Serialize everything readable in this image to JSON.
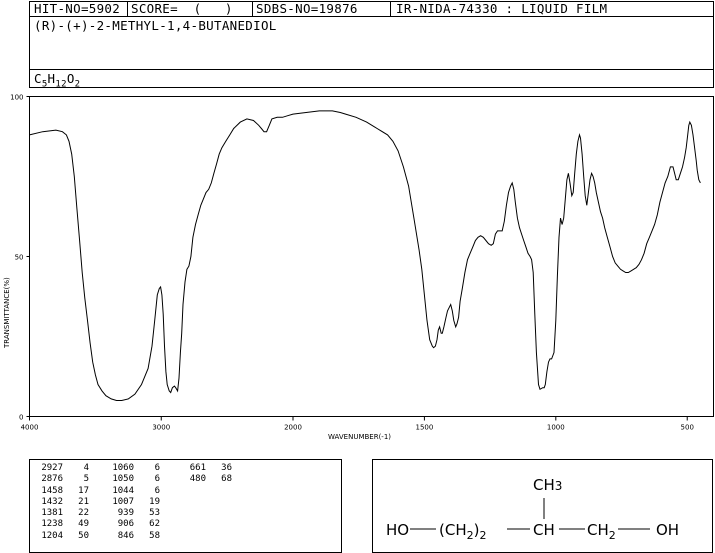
{
  "header": {
    "hit_no": "HIT-NO=5902",
    "score": "SCORE=  (   )",
    "sdbs_no": "SDBS-NO=19876",
    "ir_code": "IR-NIDA-74330 : LIQUID FILM",
    "compound_name": "(R)-(+)-2-METHYL-1,4-BUTANEDIOL",
    "formula": {
      "c": "C",
      "c_n": "5",
      "h": "H",
      "h_n": "12",
      "o": "O",
      "o_n": "2"
    }
  },
  "chart_data": {
    "type": "line",
    "ylabel": "TRANSMITTANCE(%)",
    "xlabel": "WAVENUMBER(-1)",
    "xlim": [
      4000,
      400
    ],
    "ylim": [
      0,
      100
    ],
    "x_ticks": [
      "4000",
      "3000",
      "2000",
      "1500",
      "1000",
      "500"
    ],
    "y_ticks": [
      "100",
      "50",
      "0"
    ],
    "series": [
      {
        "points": [
          [
            4000,
            88
          ],
          [
            3900,
            89
          ],
          [
            3800,
            89.5
          ],
          [
            3750,
            89
          ],
          [
            3720,
            88
          ],
          [
            3700,
            86
          ],
          [
            3680,
            82
          ],
          [
            3660,
            75
          ],
          [
            3640,
            65
          ],
          [
            3620,
            55
          ],
          [
            3600,
            45
          ],
          [
            3580,
            37
          ],
          [
            3560,
            30
          ],
          [
            3540,
            23
          ],
          [
            3520,
            17
          ],
          [
            3500,
            13
          ],
          [
            3480,
            10
          ],
          [
            3450,
            8
          ],
          [
            3420,
            6.5
          ],
          [
            3380,
            5.5
          ],
          [
            3340,
            5
          ],
          [
            3300,
            5
          ],
          [
            3250,
            5.5
          ],
          [
            3200,
            7
          ],
          [
            3150,
            10
          ],
          [
            3100,
            15
          ],
          [
            3070,
            22
          ],
          [
            3050,
            30
          ],
          [
            3030,
            38
          ],
          [
            3015,
            40
          ],
          [
            3005,
            40.5
          ],
          [
            2995,
            38
          ],
          [
            2985,
            32
          ],
          [
            2975,
            22
          ],
          [
            2965,
            14
          ],
          [
            2955,
            10
          ],
          [
            2940,
            8
          ],
          [
            2928,
            7.5
          ],
          [
            2915,
            9
          ],
          [
            2900,
            9.5
          ],
          [
            2890,
            9
          ],
          [
            2876,
            8
          ],
          [
            2865,
            12
          ],
          [
            2855,
            20
          ],
          [
            2845,
            26
          ],
          [
            2835,
            35
          ],
          [
            2820,
            42
          ],
          [
            2805,
            46
          ],
          [
            2790,
            47
          ],
          [
            2775,
            50
          ],
          [
            2760,
            56
          ],
          [
            2740,
            60
          ],
          [
            2720,
            63
          ],
          [
            2700,
            66
          ],
          [
            2680,
            68
          ],
          [
            2660,
            70
          ],
          [
            2640,
            71
          ],
          [
            2620,
            73
          ],
          [
            2600,
            76
          ],
          [
            2580,
            79
          ],
          [
            2560,
            82
          ],
          [
            2540,
            84
          ],
          [
            2510,
            86
          ],
          [
            2480,
            88
          ],
          [
            2450,
            90
          ],
          [
            2400,
            92
          ],
          [
            2350,
            93
          ],
          [
            2300,
            92.5
          ],
          [
            2260,
            91
          ],
          [
            2240,
            90
          ],
          [
            2220,
            89
          ],
          [
            2200,
            89
          ],
          [
            2180,
            91
          ],
          [
            2160,
            93
          ],
          [
            2120,
            93.5
          ],
          [
            2080,
            93.5
          ],
          [
            2040,
            94
          ],
          [
            2000,
            94.5
          ],
          [
            1950,
            95
          ],
          [
            1900,
            95.5
          ],
          [
            1850,
            95.5
          ],
          [
            1820,
            95
          ],
          [
            1800,
            94.5
          ],
          [
            1760,
            93.5
          ],
          [
            1720,
            92
          ],
          [
            1680,
            90
          ],
          [
            1640,
            88
          ],
          [
            1620,
            86
          ],
          [
            1600,
            83
          ],
          [
            1580,
            78
          ],
          [
            1560,
            72
          ],
          [
            1540,
            62
          ],
          [
            1520,
            52
          ],
          [
            1510,
            46
          ],
          [
            1500,
            38
          ],
          [
            1490,
            30
          ],
          [
            1480,
            24
          ],
          [
            1470,
            22
          ],
          [
            1465,
            21.5
          ],
          [
            1458,
            22
          ],
          [
            1452,
            24
          ],
          [
            1447,
            27
          ],
          [
            1442,
            28
          ],
          [
            1436,
            26
          ],
          [
            1432,
            26
          ],
          [
            1426,
            28
          ],
          [
            1418,
            31
          ],
          [
            1412,
            33
          ],
          [
            1406,
            34
          ],
          [
            1400,
            35
          ],
          [
            1394,
            33
          ],
          [
            1388,
            30
          ],
          [
            1381,
            28
          ],
          [
            1376,
            29
          ],
          [
            1370,
            31
          ],
          [
            1364,
            36
          ],
          [
            1356,
            40
          ],
          [
            1346,
            45
          ],
          [
            1336,
            49
          ],
          [
            1326,
            51
          ],
          [
            1316,
            53
          ],
          [
            1306,
            55
          ],
          [
            1296,
            56
          ],
          [
            1286,
            56.5
          ],
          [
            1276,
            56
          ],
          [
            1266,
            55
          ],
          [
            1256,
            54
          ],
          [
            1246,
            53.5
          ],
          [
            1238,
            54
          ],
          [
            1230,
            57
          ],
          [
            1222,
            58
          ],
          [
            1214,
            58
          ],
          [
            1204,
            58
          ],
          [
            1196,
            61
          ],
          [
            1188,
            66
          ],
          [
            1180,
            70
          ],
          [
            1172,
            72
          ],
          [
            1166,
            73
          ],
          [
            1160,
            71
          ],
          [
            1154,
            67
          ],
          [
            1146,
            62
          ],
          [
            1138,
            59
          ],
          [
            1130,
            57
          ],
          [
            1122,
            55
          ],
          [
            1114,
            53
          ],
          [
            1106,
            51
          ],
          [
            1098,
            50
          ],
          [
            1092,
            49
          ],
          [
            1086,
            45
          ],
          [
            1080,
            32
          ],
          [
            1074,
            20
          ],
          [
            1066,
            10
          ],
          [
            1060,
            8.5
          ],
          [
            1050,
            9
          ],
          [
            1044,
            9
          ],
          [
            1040,
            10
          ],
          [
            1034,
            14
          ],
          [
            1028,
            17
          ],
          [
            1022,
            18
          ],
          [
            1016,
            18
          ],
          [
            1007,
            20
          ],
          [
            1000,
            30
          ],
          [
            994,
            44
          ],
          [
            988,
            56
          ],
          [
            982,
            62
          ],
          [
            976,
            60
          ],
          [
            970,
            62
          ],
          [
            964,
            68
          ],
          [
            958,
            74
          ],
          [
            952,
            76
          ],
          [
            946,
            73
          ],
          [
            939,
            69
          ],
          [
            934,
            70
          ],
          [
            928,
            76
          ],
          [
            922,
            82
          ],
          [
            916,
            86
          ],
          [
            910,
            88
          ],
          [
            906,
            87
          ],
          [
            900,
            82
          ],
          [
            894,
            75
          ],
          [
            888,
            69
          ],
          [
            882,
            66
          ],
          [
            876,
            70
          ],
          [
            870,
            74
          ],
          [
            864,
            76
          ],
          [
            858,
            75
          ],
          [
            852,
            73
          ],
          [
            846,
            70
          ],
          [
            838,
            67
          ],
          [
            830,
            64
          ],
          [
            822,
            62
          ],
          [
            814,
            59
          ],
          [
            804,
            56
          ],
          [
            794,
            53
          ],
          [
            784,
            50
          ],
          [
            774,
            48
          ],
          [
            764,
            47
          ],
          [
            754,
            46
          ],
          [
            744,
            45.5
          ],
          [
            734,
            45
          ],
          [
            724,
            45
          ],
          [
            714,
            45.5
          ],
          [
            704,
            46
          ],
          [
            694,
            46.5
          ],
          [
            684,
            47.5
          ],
          [
            674,
            49
          ],
          [
            664,
            51
          ],
          [
            654,
            54
          ],
          [
            644,
            56
          ],
          [
            634,
            58
          ],
          [
            624,
            60
          ],
          [
            614,
            63
          ],
          [
            604,
            67
          ],
          [
            594,
            70
          ],
          [
            584,
            73
          ],
          [
            574,
            75
          ],
          [
            564,
            78
          ],
          [
            554,
            78
          ],
          [
            548,
            76
          ],
          [
            542,
            74
          ],
          [
            534,
            74
          ],
          [
            526,
            76
          ],
          [
            518,
            78
          ],
          [
            510,
            81
          ],
          [
            504,
            84
          ],
          [
            498,
            88
          ],
          [
            494,
            91
          ],
          [
            490,
            92
          ],
          [
            484,
            91
          ],
          [
            478,
            88
          ],
          [
            472,
            84
          ],
          [
            466,
            80
          ],
          [
            462,
            77
          ],
          [
            456,
            74
          ],
          [
            450,
            73
          ]
        ]
      }
    ]
  },
  "peak_table": {
    "col1": [
      {
        "w": "2927",
        "t": "4"
      },
      {
        "w": "2876",
        "t": "5"
      },
      {
        "w": "1458",
        "t": "17"
      },
      {
        "w": "1432",
        "t": "21"
      },
      {
        "w": "1381",
        "t": "22"
      },
      {
        "w": "1238",
        "t": "49"
      },
      {
        "w": "1204",
        "t": "50"
      }
    ],
    "col2": [
      {
        "w": "1060",
        "t": "6"
      },
      {
        "w": "1050",
        "t": "6"
      },
      {
        "w": "1044",
        "t": "6"
      },
      {
        "w": "1007",
        "t": "19"
      },
      {
        "w": "939",
        "t": "53"
      },
      {
        "w": "906",
        "t": "62"
      },
      {
        "w": "846",
        "t": "58"
      }
    ],
    "col3": [
      {
        "w": "661",
        "t": "36"
      },
      {
        "w": "480",
        "t": "68"
      }
    ]
  },
  "structure": {
    "ch3": "CH",
    "ch3_sub": "3",
    "ho": "HO",
    "ch2_group": "(CH",
    "ch2_sub": "2",
    "ch2_close": ")",
    "ch2_n": "2",
    "ch": "CH",
    "ch2b": "CH",
    "ch2b_sub": "2",
    "oh": "OH"
  }
}
